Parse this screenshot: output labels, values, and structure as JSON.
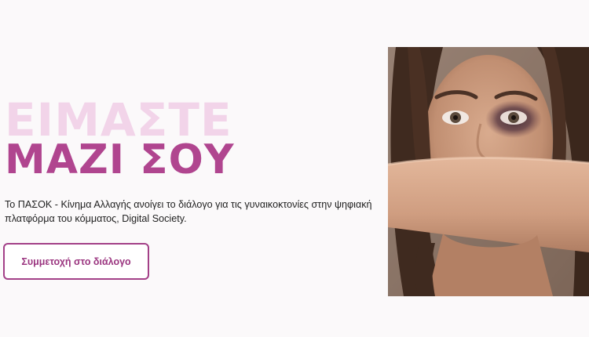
{
  "hero": {
    "line1": "ΕΙΜΑΣΤΕ",
    "line2": "ΜΑΖΙ ΣΟΥ"
  },
  "description": "Το ΠΑΣΟΚ - Κίνημα Αλλαγής ανοίγει το διάλογο για τις γυναικοκτονίες στην ψηφιακή πλατφόρμα του κόμματος, Digital Society.",
  "cta": {
    "label": "Συμμετοχή στο διάλογο"
  },
  "colors": {
    "line1": "#f2d4e9",
    "line2": "#b0458f",
    "accent": "#a34088",
    "text": "#222222",
    "background": "#fbf9fa"
  }
}
